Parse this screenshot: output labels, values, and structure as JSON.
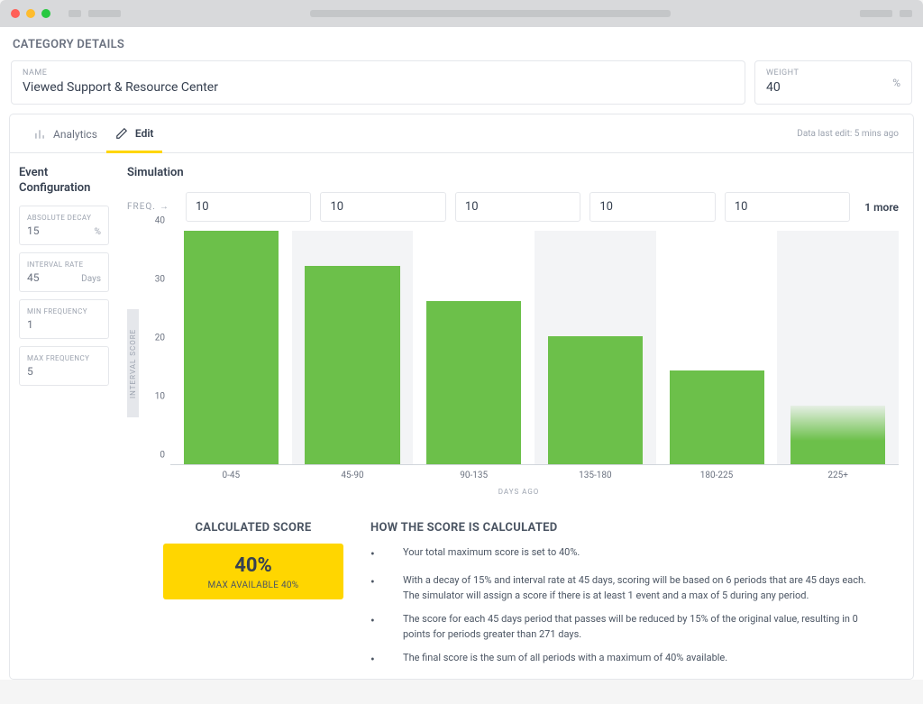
{
  "page_title": "CATEGORY DETAILS",
  "name_field": {
    "label": "NAME",
    "value": "Viewed Support & Resource Center"
  },
  "weight_field": {
    "label": "WEIGHT",
    "value": "40",
    "unit": "%"
  },
  "tabs": {
    "analytics": "Analytics",
    "edit": "Edit"
  },
  "last_edit": "Data last edit: 5 mins ago",
  "sidebar_title": "Event Configuration",
  "config": {
    "absolute_decay": {
      "label": "ABSOLUTE DECAY",
      "value": "15",
      "unit": "%"
    },
    "interval_rate": {
      "label": "INTERVAL RATE",
      "value": "45",
      "unit": "Days"
    },
    "min_frequency": {
      "label": "MIN FREQUENCY",
      "value": "1"
    },
    "max_frequency": {
      "label": "MAX FREQUENCY",
      "value": "5"
    }
  },
  "simulation": {
    "title": "Simulation",
    "freq_label": "FREQ.",
    "freq_values": [
      "10",
      "10",
      "10",
      "10",
      "10"
    ],
    "more_label": "1 more"
  },
  "chart_data": {
    "type": "bar",
    "categories": [
      "0-45",
      "45-90",
      "90-135",
      "135-180",
      "180-225",
      "225+"
    ],
    "values": [
      40,
      34,
      28,
      22,
      16,
      10
    ],
    "ylim": [
      0,
      40
    ],
    "y_ticks": [
      0,
      10,
      20,
      30,
      40
    ],
    "ylabel": "INTERVAL SCORE",
    "xlabel": "DAYS AGO",
    "title": "",
    "last_bar_faded": true
  },
  "score": {
    "title": "CALCULATED SCORE",
    "percent": "40%",
    "subtitle": "MAX AVAILABLE 40%"
  },
  "how": {
    "title": "HOW THE SCORE IS CALCULATED",
    "items": [
      "Your total maximum score is set to 40%.",
      "With a decay of 15% and interval rate at 45 days, scoring will be based on 6 periods that are 45 days each. The simulator will assign a score if there is at least 1 event and a max of 5 during any period.",
      "The score for each 45 days period that passes will be reduced by 15% of the original value, resulting in 0 points for periods greater than 271 days.",
      "The final score is the sum of all periods with a maximum of 40% available."
    ]
  }
}
